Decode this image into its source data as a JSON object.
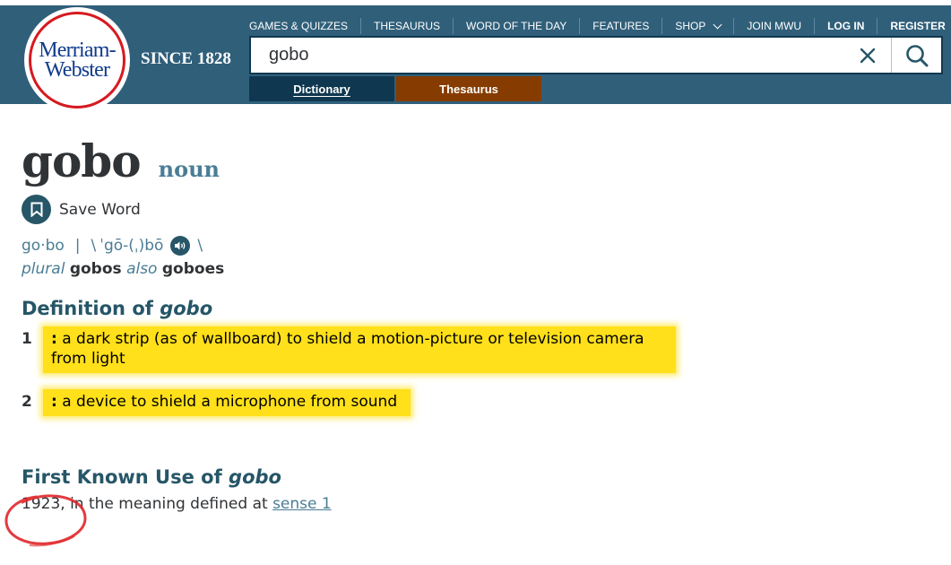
{
  "header": {
    "logo_line1": "Merriam-",
    "logo_line2": "Webster",
    "since": "SINCE 1828",
    "nav": [
      {
        "label": "GAMES & QUIZZES"
      },
      {
        "label": "THESAURUS"
      },
      {
        "label": "WORD OF THE DAY"
      },
      {
        "label": "FEATURES"
      },
      {
        "label": "SHOP"
      },
      {
        "label": "JOIN MWU"
      },
      {
        "label": "LOG IN"
      },
      {
        "label": "REGISTER"
      }
    ],
    "search": {
      "value": "gobo",
      "clear_icon": "close-icon",
      "search_icon": "search-icon"
    },
    "tabs": [
      {
        "label": "Dictionary",
        "active": true
      },
      {
        "label": "Thesaurus",
        "active": false
      }
    ],
    "colors": {
      "brand": "#305f7a",
      "dictionary_tab": "#0f3850",
      "thesaurus_tab": "#863c00",
      "logo_red": "#d71920"
    }
  },
  "entry": {
    "headword": "gobo",
    "part_of_speech": "noun",
    "save_label": "Save Word",
    "syllables": "go·bo",
    "separator": "|",
    "pron_open": "\\",
    "pronunciation": "ˈgō-(ˌ)bō",
    "pron_close": "\\",
    "plural_label": "plural",
    "plural_1": "gobos",
    "also_label": "also",
    "plural_2": "goboes",
    "definition_heading": "Definition of",
    "definition_word": "gobo",
    "senses": [
      {
        "num": "1",
        "colon": ":",
        "text": " a dark strip (as of wallboard) to shield a motion-picture or television camera from light"
      },
      {
        "num": "2",
        "colon": ":",
        "text": " a device to shield a microphone from sound"
      }
    ],
    "first_use_heading": "First Known Use of",
    "first_use_word": "gobo",
    "first_use_text": "1923, in the meaning defined at ",
    "first_use_link": "sense 1",
    "highlight_color": "#ffe01a",
    "annotation_color": "#e0262a"
  }
}
